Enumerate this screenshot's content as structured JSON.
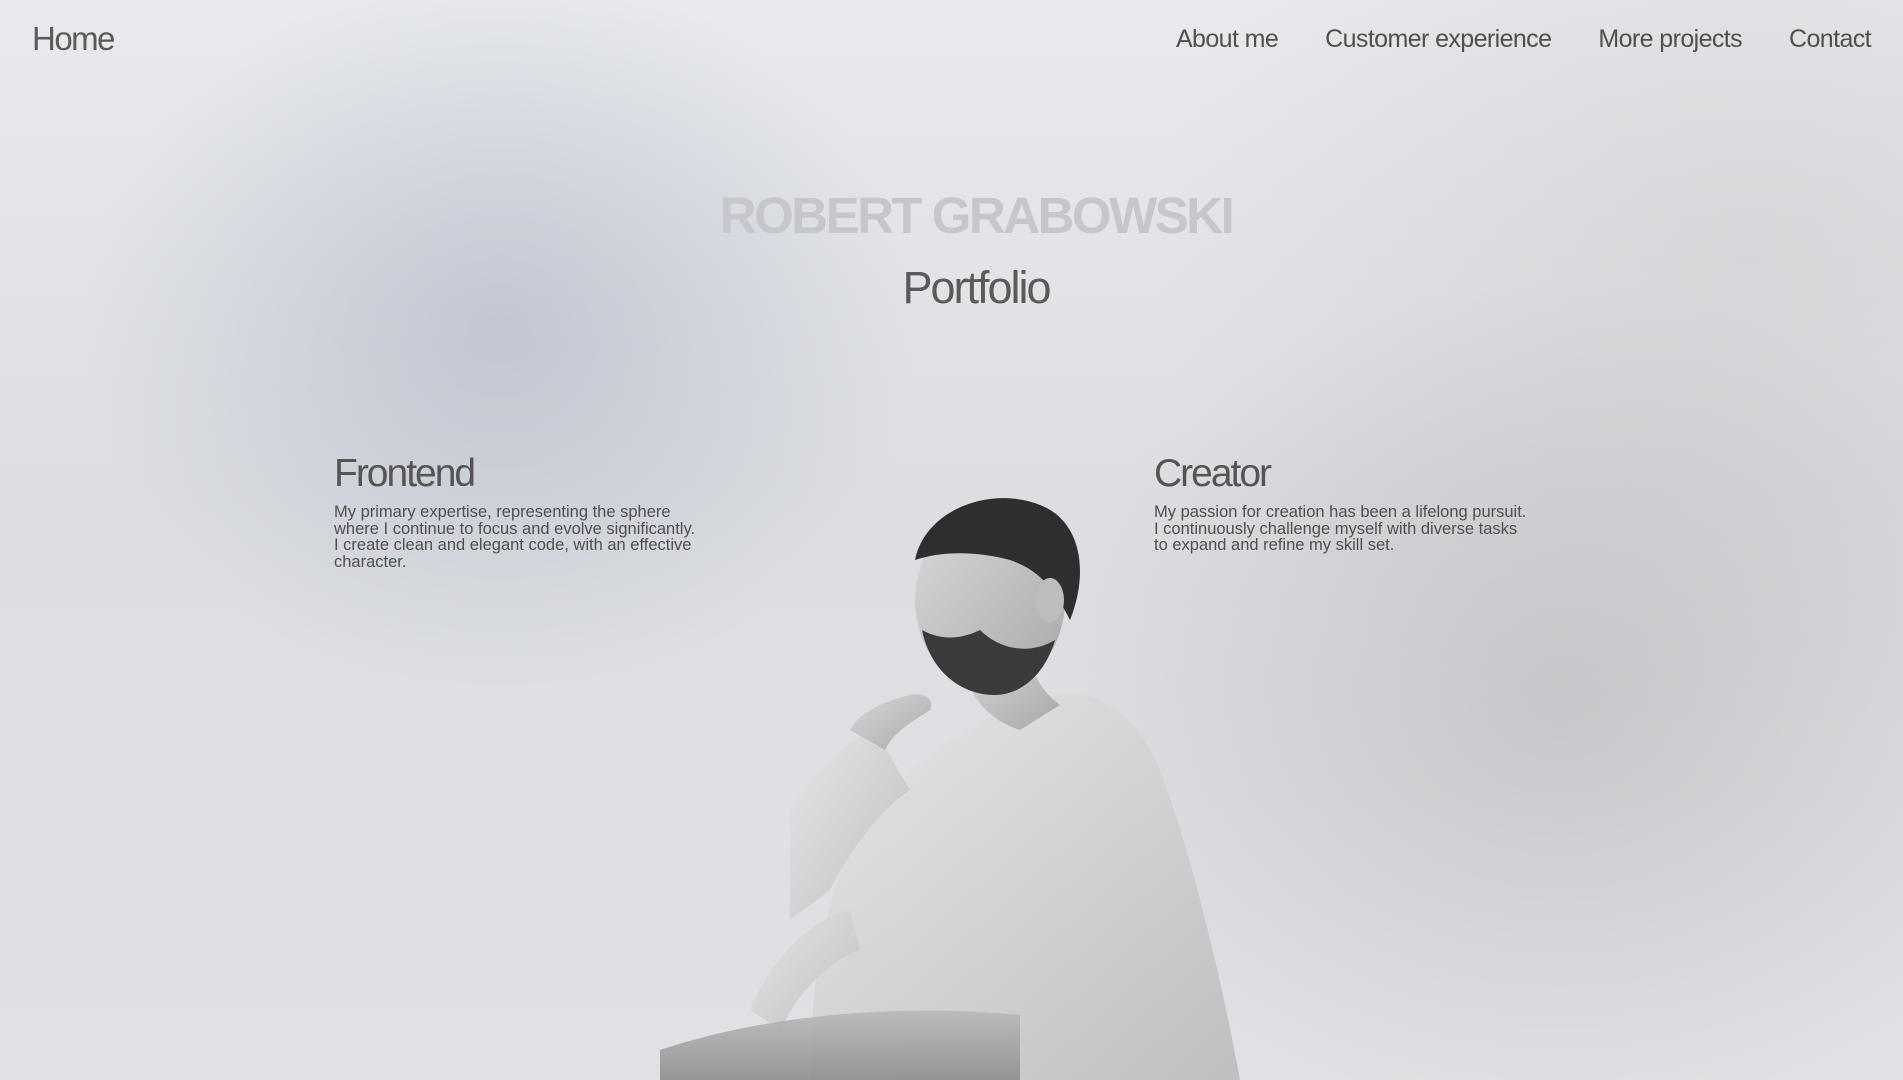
{
  "nav": {
    "home_label": "Home",
    "links": [
      {
        "label": "About me"
      },
      {
        "label": "Customer experience"
      },
      {
        "label": "More projects"
      },
      {
        "label": "Contact"
      }
    ]
  },
  "hero": {
    "name": "ROBERT GRABOWSKI",
    "subtitle": "Portfolio"
  },
  "features": [
    {
      "title": "Frontend",
      "lines": [
        "My primary expertise, representing the sphere",
        "where I continue to focus and evolve significantly.",
        "I create clean and elegant code, with an effective",
        "character."
      ]
    },
    {
      "title": "Creator",
      "lines": [
        "My passion for creation has been a lifelong pursuit.",
        "I continuously challenge myself with diverse tasks",
        "to expand and refine my skill set."
      ]
    }
  ],
  "colors": {
    "background": "#e2e4e8",
    "text_dark": "#555555",
    "name_light": "#c5c7cb"
  },
  "portrait": {
    "icon": "man-portrait-photo"
  }
}
